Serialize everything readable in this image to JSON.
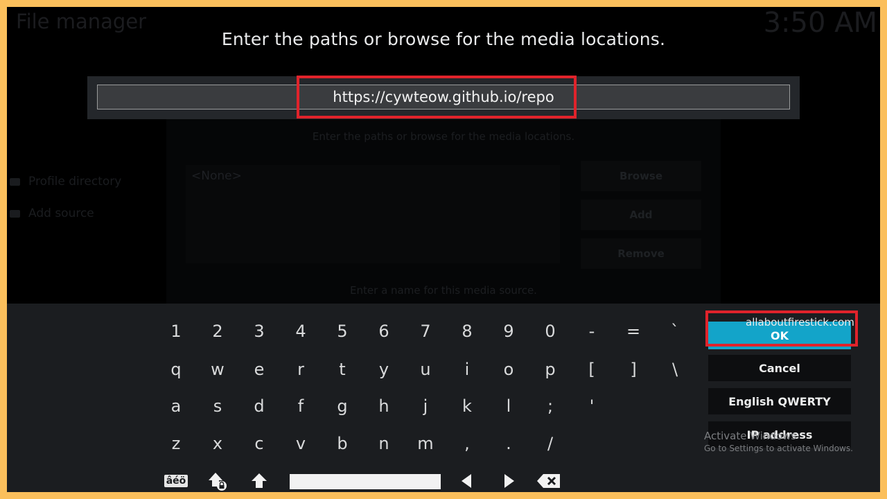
{
  "app": {
    "title": "File manager",
    "clock": "3:50 AM"
  },
  "sidebar": {
    "items": [
      "Profile directory",
      "Add source"
    ]
  },
  "background_dialog": {
    "hint": "Enter the paths or browse for the media locations.",
    "list_item": "<None>",
    "buttons": [
      "Browse",
      "Add",
      "Remove"
    ],
    "footer": "Enter a name for this media source."
  },
  "dialog": {
    "heading": "Enter the paths or browse for the media locations.",
    "input_value": "https://cywteow.github.io/repo"
  },
  "keyboard": {
    "rows": [
      [
        "1",
        "2",
        "3",
        "4",
        "5",
        "6",
        "7",
        "8",
        "9",
        "0",
        "-",
        "=",
        "`"
      ],
      [
        "q",
        "w",
        "e",
        "r",
        "t",
        "y",
        "u",
        "i",
        "o",
        "p",
        "[",
        "]",
        "\\"
      ],
      [
        "a",
        "s",
        "d",
        "f",
        "g",
        "h",
        "j",
        "k",
        "l",
        ";",
        "'"
      ],
      [
        "z",
        "x",
        "c",
        "v",
        "b",
        "n",
        "m",
        ",",
        ".",
        "/"
      ]
    ],
    "symbol_key_label": "âéö",
    "buttons": {
      "ok": "OK",
      "cancel": "Cancel",
      "layout": "English QWERTY",
      "ip": "IP address"
    }
  },
  "overlay": {
    "watermark": "allaboutfirestick.com",
    "activate_title": "Activate Windows",
    "activate_sub": "Go to Settings to activate Windows."
  },
  "icons": [
    "accented-chars-icon",
    "shift-lock-icon",
    "shift-icon",
    "arrow-left-icon",
    "arrow-right-icon",
    "backspace-icon"
  ],
  "colors": {
    "frame": "#fbbf5c",
    "highlight": "#e0232b",
    "ok_button": "#13a4c9"
  }
}
